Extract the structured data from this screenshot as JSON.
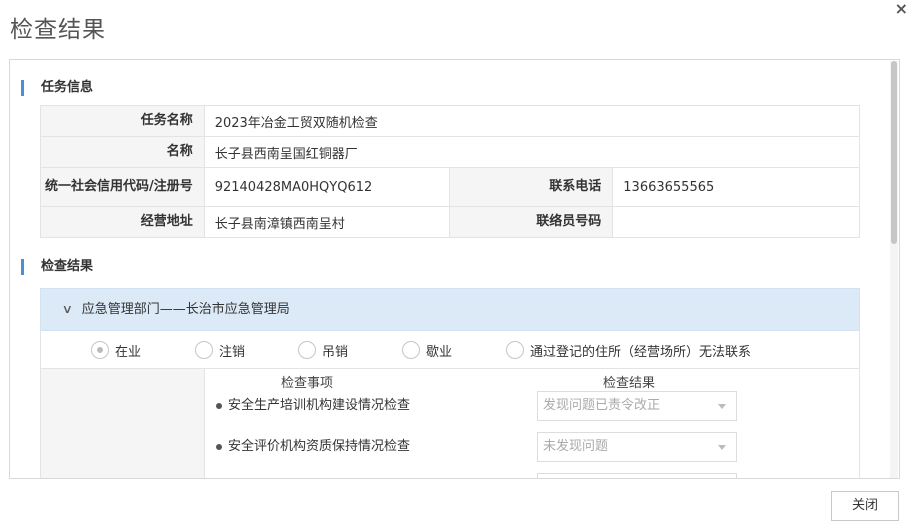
{
  "modal": {
    "title": "检查结果",
    "close_symbol": "×"
  },
  "task_section": {
    "heading": "任务信息",
    "rows": [
      {
        "label": "任务名称",
        "value": "2023年冶金工贸双随机检查"
      },
      {
        "label": "名称",
        "value": "长子县西南呈国红铜器厂"
      },
      {
        "label": "统一社会信用代码/注册号",
        "value": "92140428MA0HQYQ612",
        "label2": "联系电话",
        "value2": "13663655565"
      },
      {
        "label": "经营地址",
        "value": "长子县南漳镇西南呈村",
        "label2": "联络员号码",
        "value2": ""
      }
    ]
  },
  "result_section": {
    "heading": "检查结果",
    "department": "应急管理部门——长治市应急管理局",
    "status_options": [
      {
        "label": "在业",
        "checked": true
      },
      {
        "label": "注销",
        "checked": false
      },
      {
        "label": "吊销",
        "checked": false
      },
      {
        "label": "歇业",
        "checked": false
      },
      {
        "label": "通过登记的住所（经营场所）无法联系",
        "checked": false
      }
    ],
    "col_item": "检查事项",
    "col_result": "检查结果",
    "items": [
      {
        "name": "安全生产培训机构建设情况检查",
        "result": "发现问题已责令改正"
      },
      {
        "name": "安全评价机构资质保持情况检查",
        "result": "未发现问题"
      }
    ]
  },
  "footer": {
    "close_label": "关闭"
  },
  "icons": {
    "close": "close-icon",
    "chevron": "chevron-down-icon",
    "caret": "caret-down-icon"
  },
  "colors": {
    "accent": "#4a90d9",
    "accordion_bg": "#dce9f7",
    "label_bg": "#f5f5f5"
  }
}
